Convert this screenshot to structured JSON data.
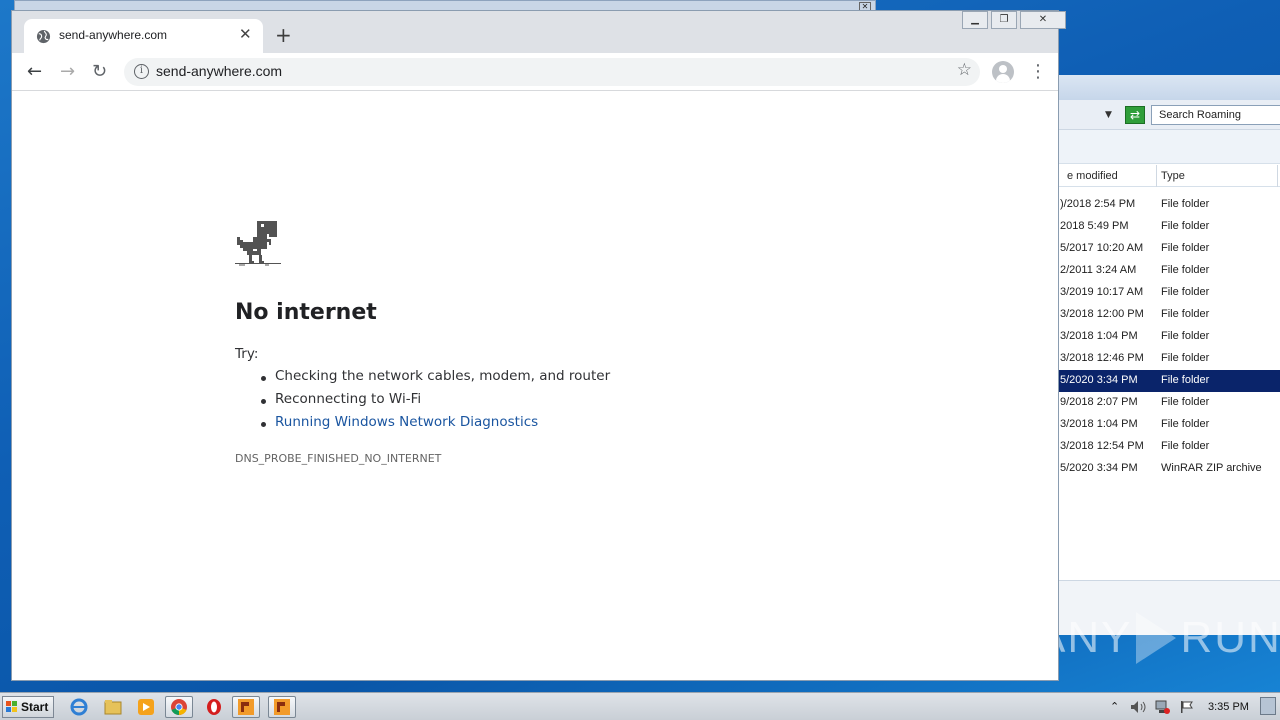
{
  "browser": {
    "tab_title": "send-anywhere.com",
    "tab_close": "✕",
    "new_tab": "+",
    "url": "send-anywhere.com",
    "back": "←",
    "forward": "→",
    "reload": "↻",
    "bookmark_star": "☆",
    "menu": "⋮",
    "info": "i",
    "window_controls": {
      "minimize": "▁",
      "restore": "❐",
      "close": "✕"
    }
  },
  "error_page": {
    "title": "No internet",
    "try_label": "Try:",
    "suggestions": [
      "Checking the network cables, modem, and router",
      "Reconnecting to Wi-Fi",
      "Running Windows Network Diagnostics"
    ],
    "error_code": "DNS_PROBE_FINISHED_NO_INTERNET"
  },
  "explorer": {
    "search_placeholder": "Search Roaming",
    "refresh_glyph": "⇄",
    "dropdown_glyph": "▼",
    "columns": {
      "date_modified": "e modified",
      "type": "Type"
    },
    "rows": [
      {
        "date": ")/2018 2:54 PM",
        "type": "File folder"
      },
      {
        "date": "2018 5:49 PM",
        "type": "File folder"
      },
      {
        "date": "5/2017 10:20 AM",
        "type": "File folder"
      },
      {
        "date": "2/2011 3:24 AM",
        "type": "File folder"
      },
      {
        "date": "3/2019 10:17 AM",
        "type": "File folder"
      },
      {
        "date": "3/2018 12:00 PM",
        "type": "File folder"
      },
      {
        "date": "3/2018 1:04 PM",
        "type": "File folder"
      },
      {
        "date": "3/2018 12:46 PM",
        "type": "File folder"
      },
      {
        "date": "5/2020 3:34 PM",
        "type": "File folder"
      },
      {
        "date": "9/2018 2:07 PM",
        "type": "File folder"
      },
      {
        "date": "3/2018 1:04 PM",
        "type": "File folder"
      },
      {
        "date": "3/2018 12:54 PM",
        "type": "File folder"
      },
      {
        "date": "5/2020 3:34 PM",
        "type": "WinRAR ZIP archive"
      }
    ],
    "selected_row_index": 8
  },
  "watermark": {
    "left": "ANY",
    "right": "RUN"
  },
  "taskbar": {
    "start_label": "Start",
    "clock": "3:35 PM",
    "tray_chevron": "⌃"
  },
  "colors": {
    "link": "#1a55a0",
    "selection": "#0a246a",
    "desktop": "#1d78c9"
  }
}
